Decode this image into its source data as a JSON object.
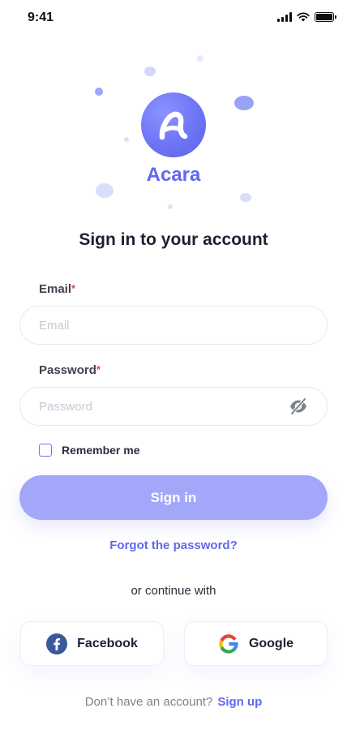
{
  "status_bar": {
    "time": "9:41",
    "icons": [
      "signal-icon",
      "wifi-icon",
      "battery-icon"
    ]
  },
  "brand": {
    "name": "Acara",
    "logo_icon": "acara-logo-icon",
    "accent": "#5F68F0"
  },
  "heading": "Sign in to your account",
  "email": {
    "label": "Email",
    "required_mark": "*",
    "placeholder": "Email",
    "value": ""
  },
  "password": {
    "label": "Password",
    "required_mark": "*",
    "placeholder": "Password",
    "value": "",
    "toggle_icon": "eye-off-icon"
  },
  "remember": {
    "label": "Remember me",
    "checked": false
  },
  "signin_button": {
    "label": "Sign in",
    "color": "#A2A7FA"
  },
  "forgot_link": "Forgot the password?",
  "continue_text": "or continue with",
  "social": {
    "facebook": {
      "label": "Facebook",
      "icon": "facebook-icon"
    },
    "google": {
      "label": "Google",
      "icon": "google-icon"
    }
  },
  "footer": {
    "text": "Don’t have an account?",
    "link": "Sign up"
  }
}
